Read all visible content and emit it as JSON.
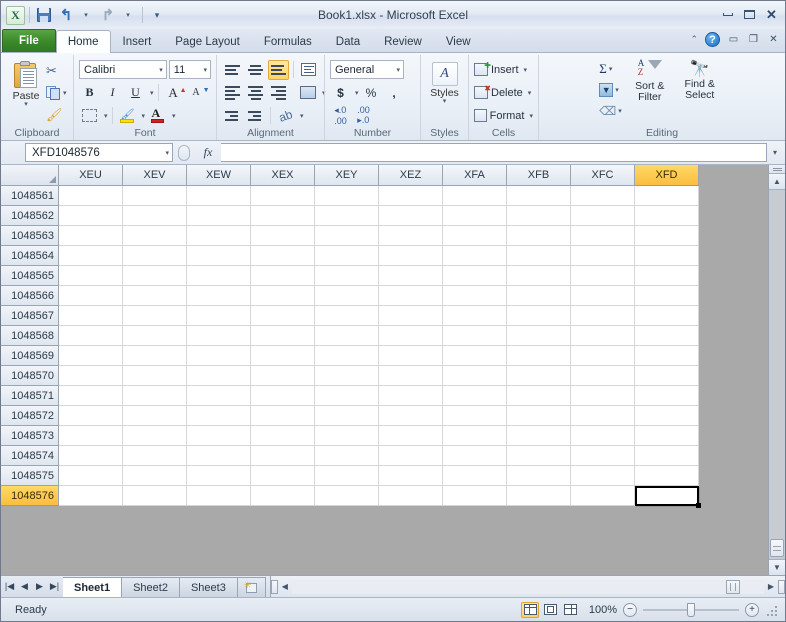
{
  "window": {
    "title": "Book1.xlsx - Microsoft Excel",
    "minimize": "Minimize",
    "maximize": "Restore Down",
    "close": "Close"
  },
  "quick_access": {
    "logo": "X",
    "save": "Save",
    "undo": "Undo",
    "redo": "Redo",
    "customize": "Customize Quick Access Toolbar"
  },
  "ribbon_tabs": [
    {
      "label": "File",
      "active": false
    },
    {
      "label": "Home",
      "active": true
    },
    {
      "label": "Insert",
      "active": false
    },
    {
      "label": "Page Layout",
      "active": false
    },
    {
      "label": "Formulas",
      "active": false
    },
    {
      "label": "Data",
      "active": false
    },
    {
      "label": "Review",
      "active": false
    },
    {
      "label": "View",
      "active": false
    }
  ],
  "ribbon_right": {
    "minimize_ribbon": "Minimize the Ribbon",
    "help": "?"
  },
  "ribbon": {
    "clipboard": {
      "title": "Clipboard",
      "paste": "Paste",
      "cut": "Cut",
      "copy": "Copy",
      "format_painter": "Format Painter"
    },
    "font": {
      "title": "Font",
      "font_name": "Calibri",
      "font_size": "11",
      "bold": "B",
      "italic": "I",
      "underline": "U",
      "grow_font": "A",
      "shrink_font": "A",
      "borders": "Borders",
      "fill_color": "Fill Color",
      "font_color": "A"
    },
    "alignment": {
      "title": "Alignment",
      "top_align": "Top Align",
      "middle_align": "Middle Align",
      "bottom_align": "Bottom Align",
      "wrap_text": "Wrap Text",
      "align_left": "Align Text Left",
      "align_center": "Center",
      "align_right": "Align Text Right",
      "merge_center": "Merge & Center",
      "decrease_indent": "Decrease Indent",
      "increase_indent": "Increase Indent",
      "orientation": "Orientation"
    },
    "number": {
      "title": "Number",
      "format": "General",
      "accounting": "$",
      "percent": "%",
      "comma": ",",
      "increase_decimal": ".00",
      "decrease_decimal": ".00"
    },
    "styles": {
      "title": "Styles",
      "label": "Styles"
    },
    "cells": {
      "title": "Cells",
      "insert": "Insert",
      "delete": "Delete",
      "format": "Format"
    },
    "editing": {
      "title": "Editing",
      "autosum": "Σ",
      "fill": "Fill",
      "clear": "Clear",
      "sort_filter_line1": "Sort &",
      "sort_filter_line2": "Filter",
      "find_select_line1": "Find &",
      "find_select_line2": "Select"
    }
  },
  "formula_bar": {
    "name_box": "XFD1048576",
    "fx": "fx",
    "formula": "",
    "placeholder": ""
  },
  "grid": {
    "columns": [
      "XEU",
      "XEV",
      "XEW",
      "XEX",
      "XEY",
      "XEZ",
      "XFA",
      "XFB",
      "XFC",
      "XFD"
    ],
    "selected_column": "XFD",
    "rows": [
      "1048561",
      "1048562",
      "1048563",
      "1048564",
      "1048565",
      "1048566",
      "1048567",
      "1048568",
      "1048569",
      "1048570",
      "1048571",
      "1048572",
      "1048573",
      "1048574",
      "1048575",
      "1048576"
    ],
    "selected_row": "1048576",
    "selected_cell": "XFD1048576",
    "select_all": "Select All"
  },
  "sheet_bar": {
    "first_nav": "First Sheet",
    "prev_nav": "Previous Sheet",
    "next_nav": "Next Sheet",
    "last_nav": "Last Sheet",
    "tabs": [
      {
        "label": "Sheet1",
        "active": true
      },
      {
        "label": "Sheet2",
        "active": false
      },
      {
        "label": "Sheet3",
        "active": false
      }
    ],
    "insert_worksheet": "Insert Worksheet"
  },
  "status_bar": {
    "status": "Ready",
    "views": [
      {
        "name": "Normal",
        "active": true
      },
      {
        "name": "Page Layout",
        "active": false
      },
      {
        "name": "Page Break Preview",
        "active": false
      }
    ],
    "zoom": "100%",
    "zoom_out": "−",
    "zoom_in": "+"
  },
  "colors": {
    "selection_header": "#ffd966",
    "file_tab_green": "#3d8a2c",
    "grid_line": "#d4d8de",
    "outside_grid": "#a9a9a9"
  }
}
